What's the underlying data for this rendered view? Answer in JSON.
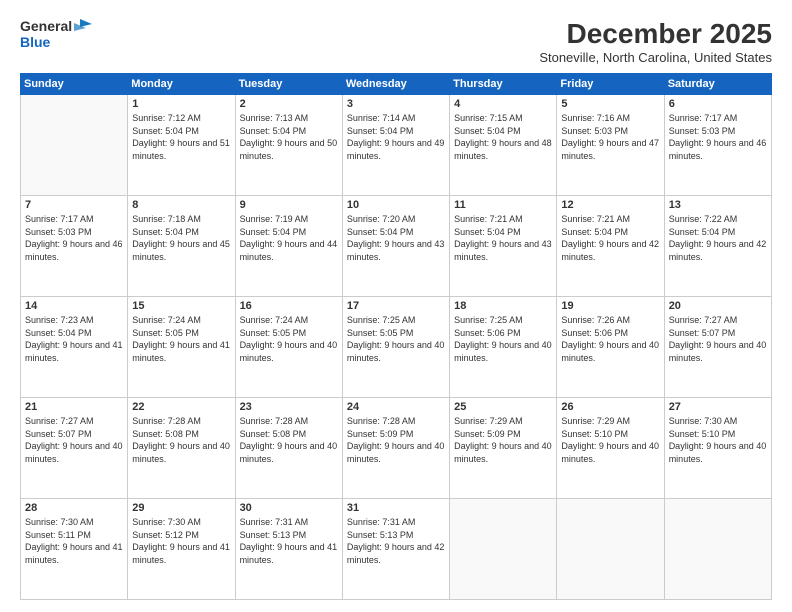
{
  "header": {
    "logo_line1": "General",
    "logo_line2": "Blue",
    "month": "December 2025",
    "location": "Stoneville, North Carolina, United States"
  },
  "weekdays": [
    "Sunday",
    "Monday",
    "Tuesday",
    "Wednesday",
    "Thursday",
    "Friday",
    "Saturday"
  ],
  "weeks": [
    [
      {
        "day": "",
        "sunrise": "",
        "sunset": "",
        "daylight": "",
        "empty": true
      },
      {
        "day": "1",
        "sunrise": "Sunrise: 7:12 AM",
        "sunset": "Sunset: 5:04 PM",
        "daylight": "Daylight: 9 hours and 51 minutes."
      },
      {
        "day": "2",
        "sunrise": "Sunrise: 7:13 AM",
        "sunset": "Sunset: 5:04 PM",
        "daylight": "Daylight: 9 hours and 50 minutes."
      },
      {
        "day": "3",
        "sunrise": "Sunrise: 7:14 AM",
        "sunset": "Sunset: 5:04 PM",
        "daylight": "Daylight: 9 hours and 49 minutes."
      },
      {
        "day": "4",
        "sunrise": "Sunrise: 7:15 AM",
        "sunset": "Sunset: 5:04 PM",
        "daylight": "Daylight: 9 hours and 48 minutes."
      },
      {
        "day": "5",
        "sunrise": "Sunrise: 7:16 AM",
        "sunset": "Sunset: 5:03 PM",
        "daylight": "Daylight: 9 hours and 47 minutes."
      },
      {
        "day": "6",
        "sunrise": "Sunrise: 7:17 AM",
        "sunset": "Sunset: 5:03 PM",
        "daylight": "Daylight: 9 hours and 46 minutes."
      }
    ],
    [
      {
        "day": "7",
        "sunrise": "Sunrise: 7:17 AM",
        "sunset": "Sunset: 5:03 PM",
        "daylight": "Daylight: 9 hours and 46 minutes."
      },
      {
        "day": "8",
        "sunrise": "Sunrise: 7:18 AM",
        "sunset": "Sunset: 5:04 PM",
        "daylight": "Daylight: 9 hours and 45 minutes."
      },
      {
        "day": "9",
        "sunrise": "Sunrise: 7:19 AM",
        "sunset": "Sunset: 5:04 PM",
        "daylight": "Daylight: 9 hours and 44 minutes."
      },
      {
        "day": "10",
        "sunrise": "Sunrise: 7:20 AM",
        "sunset": "Sunset: 5:04 PM",
        "daylight": "Daylight: 9 hours and 43 minutes."
      },
      {
        "day": "11",
        "sunrise": "Sunrise: 7:21 AM",
        "sunset": "Sunset: 5:04 PM",
        "daylight": "Daylight: 9 hours and 43 minutes."
      },
      {
        "day": "12",
        "sunrise": "Sunrise: 7:21 AM",
        "sunset": "Sunset: 5:04 PM",
        "daylight": "Daylight: 9 hours and 42 minutes."
      },
      {
        "day": "13",
        "sunrise": "Sunrise: 7:22 AM",
        "sunset": "Sunset: 5:04 PM",
        "daylight": "Daylight: 9 hours and 42 minutes."
      }
    ],
    [
      {
        "day": "14",
        "sunrise": "Sunrise: 7:23 AM",
        "sunset": "Sunset: 5:04 PM",
        "daylight": "Daylight: 9 hours and 41 minutes."
      },
      {
        "day": "15",
        "sunrise": "Sunrise: 7:24 AM",
        "sunset": "Sunset: 5:05 PM",
        "daylight": "Daylight: 9 hours and 41 minutes."
      },
      {
        "day": "16",
        "sunrise": "Sunrise: 7:24 AM",
        "sunset": "Sunset: 5:05 PM",
        "daylight": "Daylight: 9 hours and 40 minutes."
      },
      {
        "day": "17",
        "sunrise": "Sunrise: 7:25 AM",
        "sunset": "Sunset: 5:05 PM",
        "daylight": "Daylight: 9 hours and 40 minutes."
      },
      {
        "day": "18",
        "sunrise": "Sunrise: 7:25 AM",
        "sunset": "Sunset: 5:06 PM",
        "daylight": "Daylight: 9 hours and 40 minutes."
      },
      {
        "day": "19",
        "sunrise": "Sunrise: 7:26 AM",
        "sunset": "Sunset: 5:06 PM",
        "daylight": "Daylight: 9 hours and 40 minutes."
      },
      {
        "day": "20",
        "sunrise": "Sunrise: 7:27 AM",
        "sunset": "Sunset: 5:07 PM",
        "daylight": "Daylight: 9 hours and 40 minutes."
      }
    ],
    [
      {
        "day": "21",
        "sunrise": "Sunrise: 7:27 AM",
        "sunset": "Sunset: 5:07 PM",
        "daylight": "Daylight: 9 hours and 40 minutes."
      },
      {
        "day": "22",
        "sunrise": "Sunrise: 7:28 AM",
        "sunset": "Sunset: 5:08 PM",
        "daylight": "Daylight: 9 hours and 40 minutes."
      },
      {
        "day": "23",
        "sunrise": "Sunrise: 7:28 AM",
        "sunset": "Sunset: 5:08 PM",
        "daylight": "Daylight: 9 hours and 40 minutes."
      },
      {
        "day": "24",
        "sunrise": "Sunrise: 7:28 AM",
        "sunset": "Sunset: 5:09 PM",
        "daylight": "Daylight: 9 hours and 40 minutes."
      },
      {
        "day": "25",
        "sunrise": "Sunrise: 7:29 AM",
        "sunset": "Sunset: 5:09 PM",
        "daylight": "Daylight: 9 hours and 40 minutes."
      },
      {
        "day": "26",
        "sunrise": "Sunrise: 7:29 AM",
        "sunset": "Sunset: 5:10 PM",
        "daylight": "Daylight: 9 hours and 40 minutes."
      },
      {
        "day": "27",
        "sunrise": "Sunrise: 7:30 AM",
        "sunset": "Sunset: 5:10 PM",
        "daylight": "Daylight: 9 hours and 40 minutes."
      }
    ],
    [
      {
        "day": "28",
        "sunrise": "Sunrise: 7:30 AM",
        "sunset": "Sunset: 5:11 PM",
        "daylight": "Daylight: 9 hours and 41 minutes."
      },
      {
        "day": "29",
        "sunrise": "Sunrise: 7:30 AM",
        "sunset": "Sunset: 5:12 PM",
        "daylight": "Daylight: 9 hours and 41 minutes."
      },
      {
        "day": "30",
        "sunrise": "Sunrise: 7:31 AM",
        "sunset": "Sunset: 5:13 PM",
        "daylight": "Daylight: 9 hours and 41 minutes."
      },
      {
        "day": "31",
        "sunrise": "Sunrise: 7:31 AM",
        "sunset": "Sunset: 5:13 PM",
        "daylight": "Daylight: 9 hours and 42 minutes."
      },
      {
        "day": "",
        "sunrise": "",
        "sunset": "",
        "daylight": "",
        "empty": true
      },
      {
        "day": "",
        "sunrise": "",
        "sunset": "",
        "daylight": "",
        "empty": true
      },
      {
        "day": "",
        "sunrise": "",
        "sunset": "",
        "daylight": "",
        "empty": true
      }
    ]
  ]
}
